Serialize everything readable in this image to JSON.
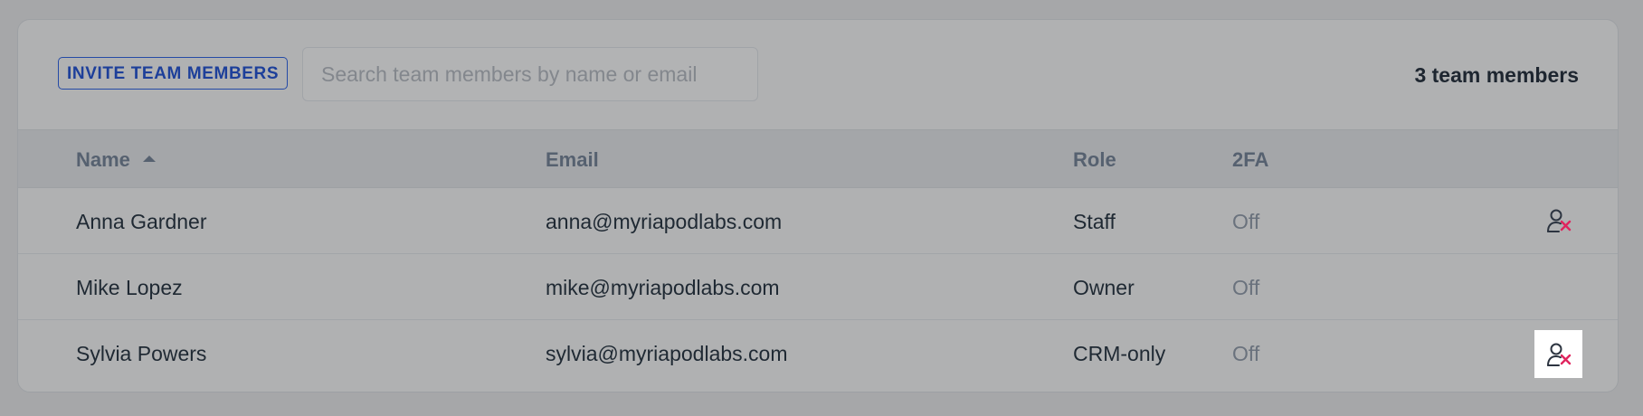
{
  "toolbar": {
    "invite_label": "INVITE TEAM MEMBERS",
    "search_placeholder": "Search team members by name or email",
    "member_count": "3 team members"
  },
  "table": {
    "columns": {
      "name": "Name",
      "email": "Email",
      "role": "Role",
      "twofa": "2FA"
    },
    "sort": {
      "column": "name",
      "direction": "ascending",
      "icon": "sort-ascending-icon"
    },
    "rows": [
      {
        "name": "Anna Gardner",
        "email": "anna@myriapodlabs.com",
        "role": "Staff",
        "twofa": "Off",
        "remove_icon": "remove-user-icon"
      },
      {
        "name": "Mike Lopez",
        "email": "mike@myriapodlabs.com",
        "role": "Owner",
        "twofa": "Off"
      },
      {
        "name": "Sylvia Powers",
        "email": "sylvia@myriapodlabs.com",
        "role": "CRM-only",
        "twofa": "Off",
        "remove_icon": "remove-user-icon",
        "remove_focused": true
      }
    ]
  },
  "colors": {
    "backdrop": "#a6a7a9",
    "accent": "#244aa6",
    "remove_icon_x": "#e0245e",
    "remove_icon_person": "#2c3440"
  }
}
